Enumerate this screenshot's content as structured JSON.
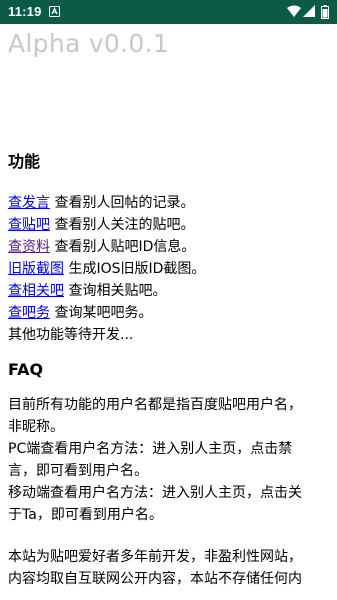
{
  "status_bar": {
    "time": "11:19",
    "notification_icon": "a-notification-icon",
    "wifi_icon": "wifi-icon",
    "signal_icon": "signal-icon",
    "battery_icon": "battery-icon"
  },
  "app": {
    "title": "Alpha v0.0.1"
  },
  "features": {
    "heading": "功能",
    "items": [
      {
        "link": "查发言",
        "desc": " 查看别人回帖的记录。"
      },
      {
        "link": "查贴吧",
        "desc": " 查看别人关注的贴吧。"
      },
      {
        "link": "查资料",
        "desc": " 查看别人贴吧ID信息。"
      },
      {
        "link": "旧版截图",
        "desc": " 生成IOS旧版ID截图。"
      },
      {
        "link": "查相关吧",
        "desc": " 查询相关贴吧。"
      },
      {
        "link": "查吧务",
        "desc": " 查询某吧吧务。"
      }
    ],
    "more": "其他功能等待开发..."
  },
  "faq": {
    "heading": "FAQ",
    "p1_line1": "目前所有功能的用户名都是指百度贴吧用户名，",
    "p1_line2": "非昵称。",
    "p2_line1": "PC端查看用户名方法：进入别人主页，点击禁",
    "p2_line2": "言，即可看到用户名。",
    "p3_line1": "移动端查看用户名方法：进入别人主页，点击关",
    "p3_line2": "于Ta，即可看到用户名。",
    "p4_line1": "本站为贴吧爱好者多年前开发，非盈利性网站，",
    "p4_line2": "内容均取自互联网公开内容，本站不存储任何内"
  },
  "colors": {
    "status_bar": "#0b5c44",
    "link": "#0000ee",
    "visited_link": "#551a8b",
    "title": "#c8c8c8"
  }
}
